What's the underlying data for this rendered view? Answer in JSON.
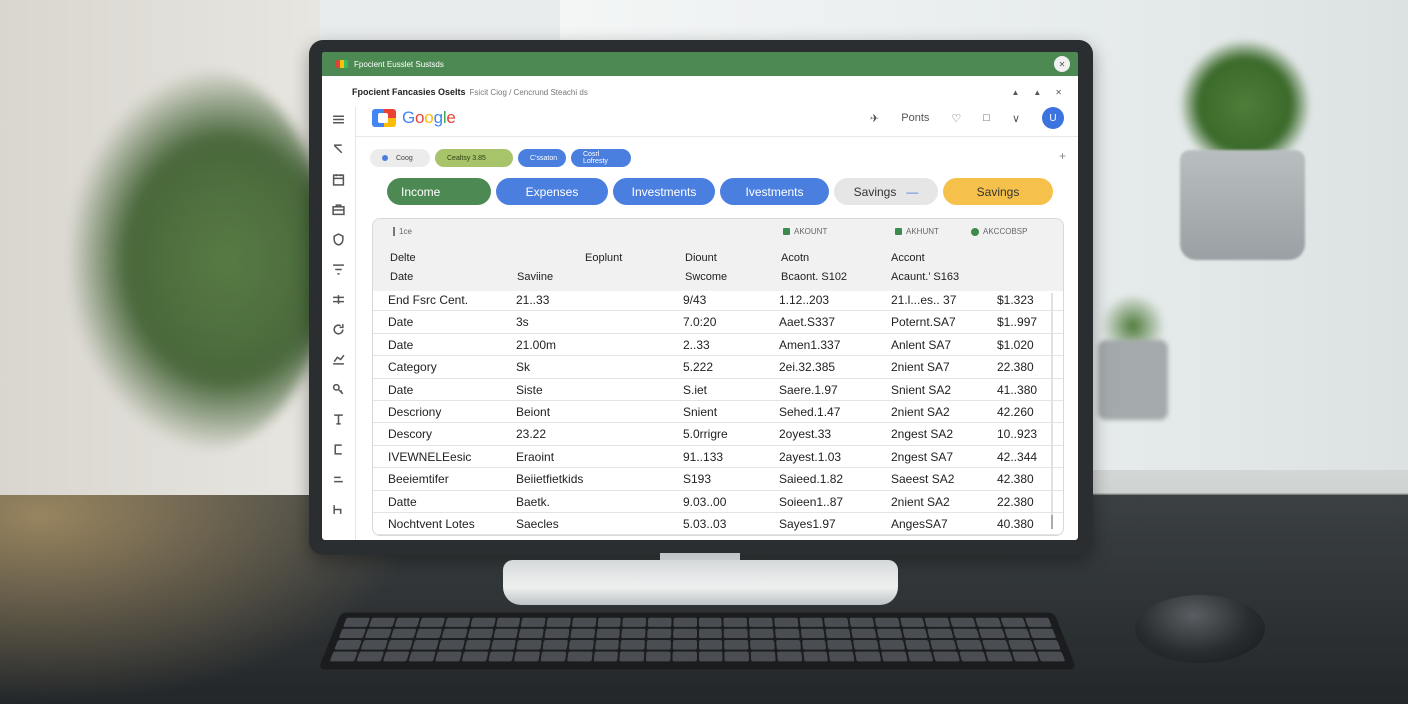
{
  "window": {
    "title": "Fpocient Eusslet Sustsds",
    "close_glyph": "✕"
  },
  "subtitle": {
    "main": "Fpocient Fancasies Oselts",
    "rest": "Fsicit Ciog / Cencrund Steachi ds",
    "icons": [
      "▲",
      "▲",
      "✕"
    ]
  },
  "sidebar_icons": [
    "menu-icon",
    "chevron-icon",
    "calendar-icon",
    "briefcase-icon",
    "shield-icon",
    "filter-icon",
    "adjust-icon",
    "refresh-icon",
    "chart-icon",
    "key-icon",
    "tool-icon",
    "clip-icon",
    "list-icon",
    "doc-icon"
  ],
  "logo": {
    "text_parts": [
      "G",
      "o",
      "o",
      "g",
      "l",
      "e"
    ]
  },
  "header": {
    "nav_glyph": "✈",
    "label": "Ponts",
    "heart_glyph": "♡",
    "bag_glyph": "□",
    "chevron_glyph": "∨",
    "avatar_letter": "U"
  },
  "chips": {
    "search": "Coog",
    "lime": "Cealtsy   3.85",
    "blue1": "C’ssaton",
    "blue2": "Cosrl Lofresty",
    "plus": "+"
  },
  "tabs": [
    "Income",
    "Expenses",
    "Investments",
    "Ivestments",
    "Savings",
    "Savings"
  ],
  "tab_grey_suffix": "—",
  "colors": {
    "topbar": "#4d8a53",
    "income_tab": "#4d8a53",
    "blue_tab": "#4a7fe0",
    "savings_tab": "#f5c14a",
    "avatar": "#3b74e0"
  },
  "table": {
    "meta": {
      "left": "1ce",
      "acc1": "AKOUNT",
      "acc2": "AKHUNT",
      "acc3": "AKCCOBSP"
    },
    "header_row1": [
      "Delte",
      "Eoplunt",
      "Diount",
      "Acotn",
      "Accont"
    ],
    "header_row2": [
      "Date",
      "Saviine",
      "Swcome",
      "Bcaont. S102",
      "Acaunt.’ S163"
    ],
    "rows": [
      [
        "End Fsrc Cent.",
        "21..33",
        "9/43",
        "1.12..203",
        "21.l...es.. 37",
        "$1.323"
      ],
      [
        "Date",
        "3s",
        "7.0:20",
        "Aaet.S337",
        "Poternt.SA7",
        "$1..997"
      ],
      [
        "Date",
        "21.00m",
        "2..33",
        "Amen1.337",
        "Anlent SA7",
        "$1.020"
      ],
      [
        "Category",
        "Sk",
        "5.222",
        "2ei.32.385",
        "2nient SA7",
        "22.380"
      ],
      [
        "Date",
        "Siste",
        "S.iet",
        "Saere.1.97",
        "Snient SA2",
        "41..380"
      ],
      [
        "Descriony",
        "Beiont",
        "Snient",
        "Sehed.1.47",
        "2nient SA2",
        "42.260"
      ],
      [
        "Descory",
        "23.22",
        "5.0rrigre",
        "2oyest.33",
        "2ngest SA2",
        "10..923"
      ],
      [
        "IVEWNELEesic",
        "Eraoint",
        "91..133",
        "2ayest.1.03",
        "2ngest SA7",
        "42..344"
      ],
      [
        "Beeiemtifer",
        "Beiietfietkids",
        "S193",
        "Saieed.1.82",
        "Saeest SA2",
        "42.380"
      ],
      [
        "Datte",
        "Baetk.",
        "9.03..00",
        "Soieen1..87",
        "2nient SA2",
        "22.380"
      ],
      [
        "Nochtvent Lotes",
        "Saecles",
        "5.03..03",
        "Sayes1.97",
        "AngesSA7",
        "40.380"
      ]
    ]
  }
}
